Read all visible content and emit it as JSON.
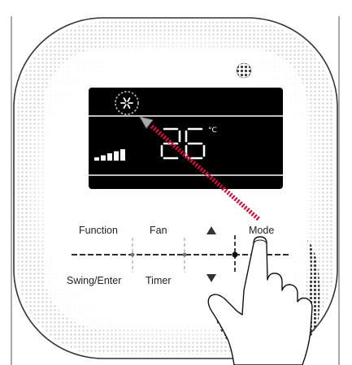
{
  "panel": {
    "buttons": {
      "function": "Function",
      "fan": "Fan",
      "mode": "Mode",
      "swing_enter": "Swing/Enter",
      "timer": "Timer"
    }
  },
  "display": {
    "temperature": "26",
    "unit": "°C",
    "mode_icon": "snowflake-icon",
    "fan_level_bars": 5
  },
  "colors": {
    "lcd_background": "#000000",
    "lcd_segments": "#ffffff",
    "pointer_arrow": "#d0103a",
    "body": "#ffffff"
  }
}
